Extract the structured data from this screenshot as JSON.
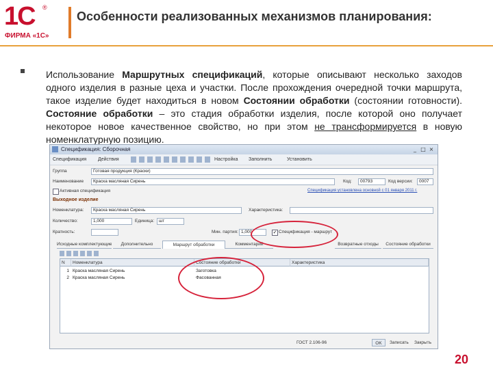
{
  "logo": {
    "main": "1С",
    "reg": "®",
    "sub": "ФИРМА «1С»"
  },
  "slide": {
    "title": "Особенности реализованных механизмов планирования:",
    "para": {
      "p1": "Использование ",
      "b1": "Маршрутных спецификаций",
      "p2": ", которые описывают несколько заходов одного изделия в разные цеха и участки. После прохождения очередной точки маршрута, такое изделие будет находиться в новом ",
      "b2": "Состоянии обработки",
      "p3": " (состоянии готовности). ",
      "b3": "Состояние обработки",
      "p4": " – это стадия обработки изделия, после которой оно получает некоторое новое качественное свойство, но при этом ",
      "u1": "не трансформируется",
      "p5": " в новую номенклатурную позицию."
    },
    "page_number": "20"
  },
  "window": {
    "title": "Спецификация: Сборочная",
    "toolbar": {
      "spec": "Спецификация",
      "actions": "Действия",
      "settings": "Настройка",
      "fill": "Заполнить",
      "set": "Установить"
    },
    "labels": {
      "group": "Группа",
      "name": "Наименование",
      "code": "Код:",
      "version": "Код версии:",
      "active": "Активная спецификация",
      "section": "Выходное изделие",
      "nomenclature": "Номенклатура:",
      "characteristic": "Характеристика:",
      "quantity": "Количество:",
      "unit": "Единица:",
      "mult": "Кратность:",
      "batch": "Мин. партия:",
      "route_spec": "Спецификация - маршрут"
    },
    "values": {
      "group": "Готовая продукция (Краски)",
      "name": "Краска масляная Сирень",
      "code": "00793",
      "version": "0007",
      "nomenclature": "Краска масляная Сирень",
      "quantity": "1,000",
      "unit": "шт",
      "batch": "1,000"
    },
    "link": "Спецификация установлена основной с 01 января 2011 г.",
    "tabs": [
      "Исходные комплектующие",
      "Дополнительно",
      "Маршрут обработки",
      "Комментарий",
      "Возвратные отходы",
      "Состояние обработки"
    ],
    "grid": {
      "headers": [
        "N",
        "Номенклатура",
        "Состояние обработки",
        "Характеристика"
      ],
      "rows": [
        {
          "n": "1",
          "name": "Краска масляная Сирень",
          "state": "Заготовка"
        },
        {
          "n": "2",
          "name": "Краска масляная Сирень",
          "state": "Фасованная"
        }
      ]
    },
    "footer": {
      "gost": "ГОСТ 2.106-96",
      "ok": "OK",
      "write": "Записать",
      "close": "Закрыть"
    }
  },
  "colors": {
    "brand": "#c8102e",
    "accent": "#e8a03a",
    "highlight": "#d6223a"
  }
}
